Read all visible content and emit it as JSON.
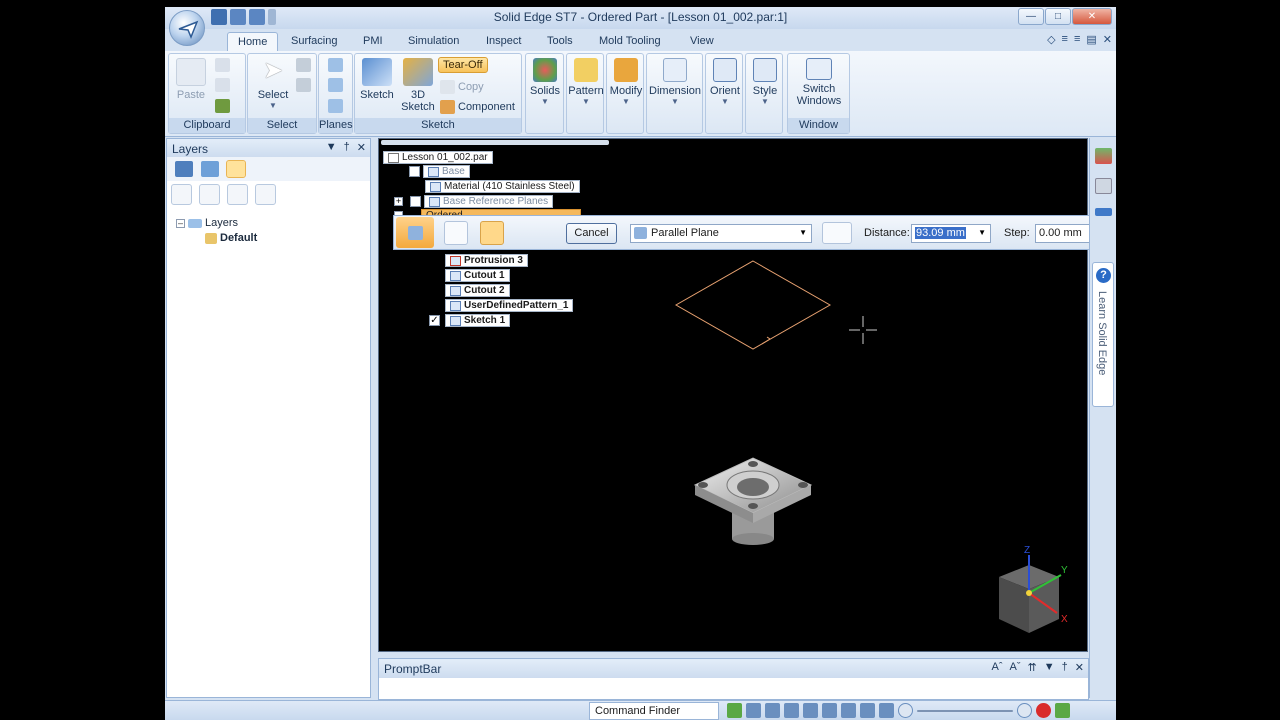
{
  "window": {
    "title": "Solid Edge ST7 - Ordered Part - [Lesson 01_002.par:1]"
  },
  "tabs": [
    {
      "label": "Home",
      "active": true
    },
    {
      "label": "Surfacing"
    },
    {
      "label": "PMI"
    },
    {
      "label": "Simulation"
    },
    {
      "label": "Inspect"
    },
    {
      "label": "Tools"
    },
    {
      "label": "Mold Tooling"
    },
    {
      "label": "View"
    }
  ],
  "ribbon": {
    "clipboard": {
      "paste": "Paste",
      "label": "Clipboard"
    },
    "select": {
      "select": "Select",
      "label": "Select"
    },
    "planes": {
      "label": "Planes"
    },
    "sketch": {
      "sketch": "Sketch",
      "sketch3d_line1": "3D",
      "sketch3d_line2": "Sketch",
      "tearoff": "Tear-Off",
      "copy": "Copy",
      "component": "Component",
      "label": "Sketch"
    },
    "solids": "Solids",
    "pattern": "Pattern",
    "modify": "Modify",
    "dimension": "Dimension",
    "orient": "Orient",
    "style": "Style",
    "window": {
      "switch_line1": "Switch",
      "switch_line2": "Windows",
      "label": "Window"
    }
  },
  "layers_pane": {
    "title": "Layers",
    "tree": {
      "root": "Layers",
      "child": "Default"
    }
  },
  "pathfinder": {
    "root": "Lesson 01_002.par",
    "items": {
      "base": "Base",
      "material": "Material (410 Stainless Steel)",
      "base_ref": "Base Reference Planes",
      "ordered": "Ordered",
      "protrusion": "Protrusion 3",
      "cutout1": "Cutout 1",
      "cutout2": "Cutout 2",
      "pattern": "UserDefinedPattern_1",
      "sketch": "Sketch 1"
    }
  },
  "command_bar": {
    "cancel": "Cancel",
    "plane_option": "Parallel Plane",
    "distance_label": "Distance:",
    "distance_value": "93.09 mm",
    "step_label": "Step:",
    "step_value": "0.00 mm"
  },
  "axes": {
    "z": "Z",
    "y": "Y",
    "x": "X"
  },
  "learn_tab": {
    "text": "Learn Solid Edge",
    "help": "?"
  },
  "promptbar": {
    "title": "PromptBar"
  },
  "statusbar": {
    "command_finder": "Command Finder"
  },
  "colors": {
    "viewport_bg": "#000000",
    "plane_outline": "#e8a271",
    "ribbon_bg": "#dde8f5",
    "highlight": "#ffd88a"
  }
}
